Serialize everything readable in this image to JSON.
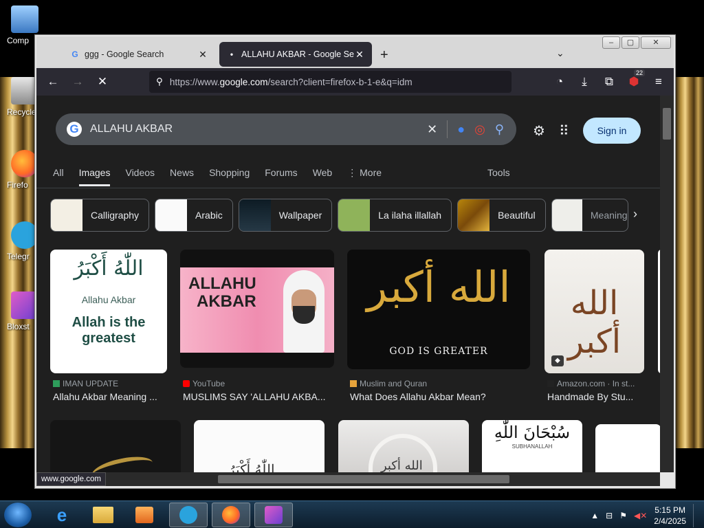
{
  "desktop": {
    "icons": [
      {
        "label": "Comp"
      },
      {
        "label": "Recycle"
      },
      {
        "label": "Firefo"
      },
      {
        "label": "Telegr"
      },
      {
        "label": "Bloxst"
      }
    ]
  },
  "browser": {
    "tabs": [
      {
        "title": "ggg - Google Search",
        "favicon": "G"
      },
      {
        "title": "ALLAHU AKBAR - Google Search",
        "favicon": "•"
      }
    ],
    "url_prefix": "https://www.",
    "url_domain": "google.com",
    "url_suffix": "/search?client=firefox-b-1-e&q=idm",
    "extension_badge": "22",
    "status_url": "www.google.com"
  },
  "google": {
    "query": "ALLAHU AKBAR",
    "sign_in": "Sign in",
    "nav_tabs": [
      "All",
      "Images",
      "Videos",
      "News",
      "Shopping",
      "Forums",
      "Web",
      "More"
    ],
    "active_tab": "Images",
    "tools": "Tools",
    "chips": [
      "Calligraphy",
      "Arabic",
      "Wallpaper",
      "La ilaha illallah",
      "Beautiful",
      "Meaning"
    ],
    "results": [
      {
        "source": "IMAN UPDATE",
        "caption": "Allahu Akbar Meaning ...",
        "image_text": [
          "اللّٰهُ أَكْبَرُ",
          "Allahu Akbar",
          "Allah is the",
          "greatest"
        ]
      },
      {
        "source": "YouTube",
        "caption": "MUSLIMS SAY 'ALLAHU AKBA...",
        "image_text": [
          "ALLAHU",
          "AKBAR"
        ]
      },
      {
        "source": "Muslim and Quran",
        "caption": "What Does Allahu Akbar Mean?",
        "image_text": [
          "الله أكبر",
          "GOD IS GREATER"
        ]
      },
      {
        "source": "Amazon.com · In st...",
        "caption": "Handmade By Stu...",
        "image_text": [
          "الله أكبر"
        ]
      }
    ],
    "row2_texts": [
      "اللّٰهُ أَكْبَرُ",
      "الله أكبر",
      "سُبْحَانَ اللّٰهِ",
      "SUBHANALLAH"
    ]
  },
  "taskbar": {
    "time": "5:15 PM",
    "date": "2/4/2025"
  },
  "colors": {
    "page_bg": "#1f1f1f",
    "sign_in_bg": "#c2e7ff",
    "tab_active_bg": "#2b2a33"
  }
}
